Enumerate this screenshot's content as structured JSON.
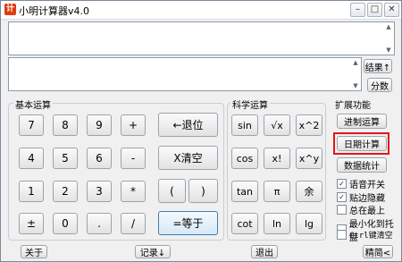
{
  "window": {
    "title": "小明计算器v4.0",
    "app_icon": "计",
    "controls": {
      "minimize": "–",
      "restore": "□",
      "close": "✕"
    }
  },
  "display": {
    "expression": "",
    "result": "",
    "scroll_up": "▲",
    "scroll_down": "▼"
  },
  "side": {
    "result_label": "结果↑",
    "fraction_label": "分数"
  },
  "basic": {
    "title": "基本运算",
    "keys": [
      "7",
      "8",
      "9",
      "+",
      "4",
      "5",
      "6",
      "-",
      "1",
      "2",
      "3",
      "*",
      "±",
      "0",
      ".",
      "/"
    ],
    "backspace": "←退位",
    "clear": "X清空",
    "lparen": "(",
    "rparen": ")",
    "equals": "=等于"
  },
  "scientific": {
    "title": "科学运算",
    "keys": [
      "sin",
      "√x",
      "x^2",
      "cos",
      "x!",
      "x^y",
      "tan",
      "π",
      "余",
      "cot",
      "ln",
      "lg"
    ]
  },
  "extensions": {
    "title": "扩展功能",
    "base_conv": "进制运算",
    "date_calc": "日期计算",
    "stats": "数据统计",
    "options": [
      {
        "label": "语音开关",
        "checked": true
      },
      {
        "label": "贴边隐藏",
        "checked": true
      },
      {
        "label": "总在最上",
        "checked": false
      },
      {
        "label": "最小化到托盘",
        "checked": false
      },
      {
        "label": "Ctrl键清空",
        "checked": false
      }
    ],
    "check_mark": "✓"
  },
  "bottom": {
    "about": "关于",
    "history": "记录↓",
    "exit": "退出",
    "simple": "精简<"
  },
  "colors": {
    "highlight": "#e8141b"
  }
}
